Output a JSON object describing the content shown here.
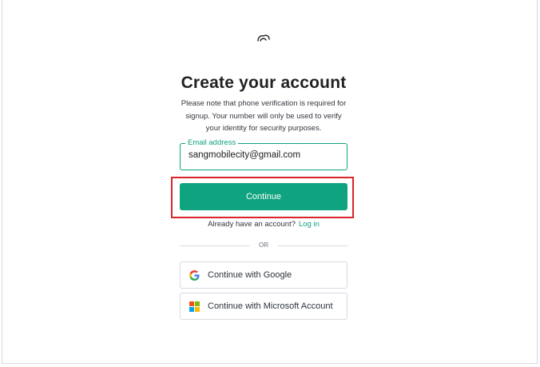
{
  "header": {
    "logo_icon": "openai-logo-icon"
  },
  "form": {
    "title": "Create your account",
    "note_lines": [
      "Please note that phone verification is required for",
      "signup. Your number will only be used to verify",
      "your identity for security purposes."
    ],
    "email": {
      "label": "Email address",
      "value": "sangmobilecity@gmail.com"
    },
    "continue_label": "Continue",
    "login_prompt": "Already have an account?",
    "login_link": "Log in",
    "divider_text": "OR",
    "google_label": "Continue with Google",
    "microsoft_label": "Continue with Microsoft Account"
  },
  "colors": {
    "accent": "#10a37f",
    "highlight": "#d9262c",
    "text": "#202123"
  }
}
